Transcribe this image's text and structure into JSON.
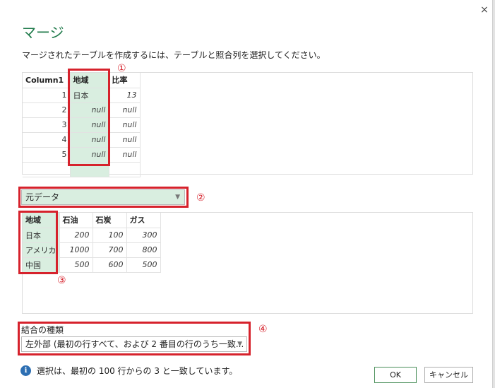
{
  "dialog": {
    "title": "マージ",
    "instruction": "マージされたテーブルを作成するには、テーブルと照合列を選択してください。",
    "close_glyph": "×"
  },
  "table1": {
    "headers": [
      "Column1",
      "地域",
      "比率"
    ],
    "rows": [
      [
        "1",
        "日本",
        "13"
      ],
      [
        "2",
        "null",
        "null"
      ],
      [
        "3",
        "null",
        "null"
      ],
      [
        "4",
        "null",
        "null"
      ],
      [
        "5",
        "null",
        "null"
      ]
    ]
  },
  "table_select": {
    "value": "元データ"
  },
  "table2": {
    "headers": [
      "地域",
      "石油",
      "石炭",
      "ガス"
    ],
    "rows": [
      [
        "日本",
        "200",
        "100",
        "300"
      ],
      [
        "アメリカ",
        "1000",
        "700",
        "800"
      ],
      [
        "中国",
        "500",
        "600",
        "500"
      ]
    ]
  },
  "join": {
    "label": "結合の種類",
    "value": "左外部 (最初の行すべて、および 2 番目の行のうち一致..."
  },
  "annotations": {
    "m1": "①",
    "m2": "②",
    "m3": "③",
    "m4": "④"
  },
  "info": {
    "text": "選択は、最初の 100 行からの 3 と一致しています。",
    "icon_glyph": "i"
  },
  "buttons": {
    "ok": "OK",
    "cancel": "キャンセル"
  },
  "colors": {
    "accent": "#1f7a4a",
    "selection": "#d9eee0",
    "annotation": "#d6222c",
    "info": "#2d6fb3"
  }
}
